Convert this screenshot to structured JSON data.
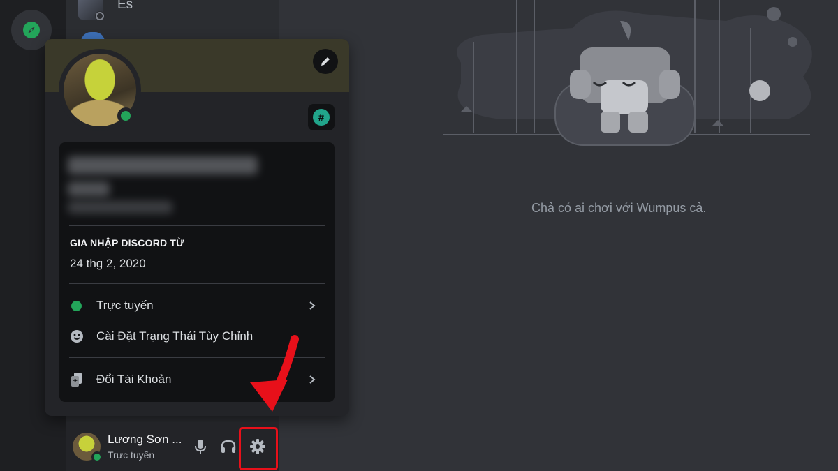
{
  "dm_list": {
    "first_name": "Es"
  },
  "popout": {
    "joined_label": "GIA NHẬP DISCORD TỪ",
    "joined_value": "24 thg 2, 2020",
    "menu": [
      {
        "label": "Trực tuyến",
        "icon": "online-status-dot"
      },
      {
        "label": "Cài Đặt Trạng Thái Tùy Chỉnh",
        "icon": "smiley-icon"
      },
      {
        "label": "Đổi Tài Khoản",
        "icon": "switch-account-icon"
      }
    ]
  },
  "user_panel": {
    "name": "Lương Sơn ...",
    "status": "Trực tuyến",
    "controls": [
      "microphone-icon",
      "headphones-icon",
      "gear-icon"
    ]
  },
  "main": {
    "empty_message": "Chả có ai chơi với Wumpus cả."
  },
  "colors": {
    "online": "#23a55a",
    "highlight": "#e8101a",
    "background": "#313338"
  }
}
